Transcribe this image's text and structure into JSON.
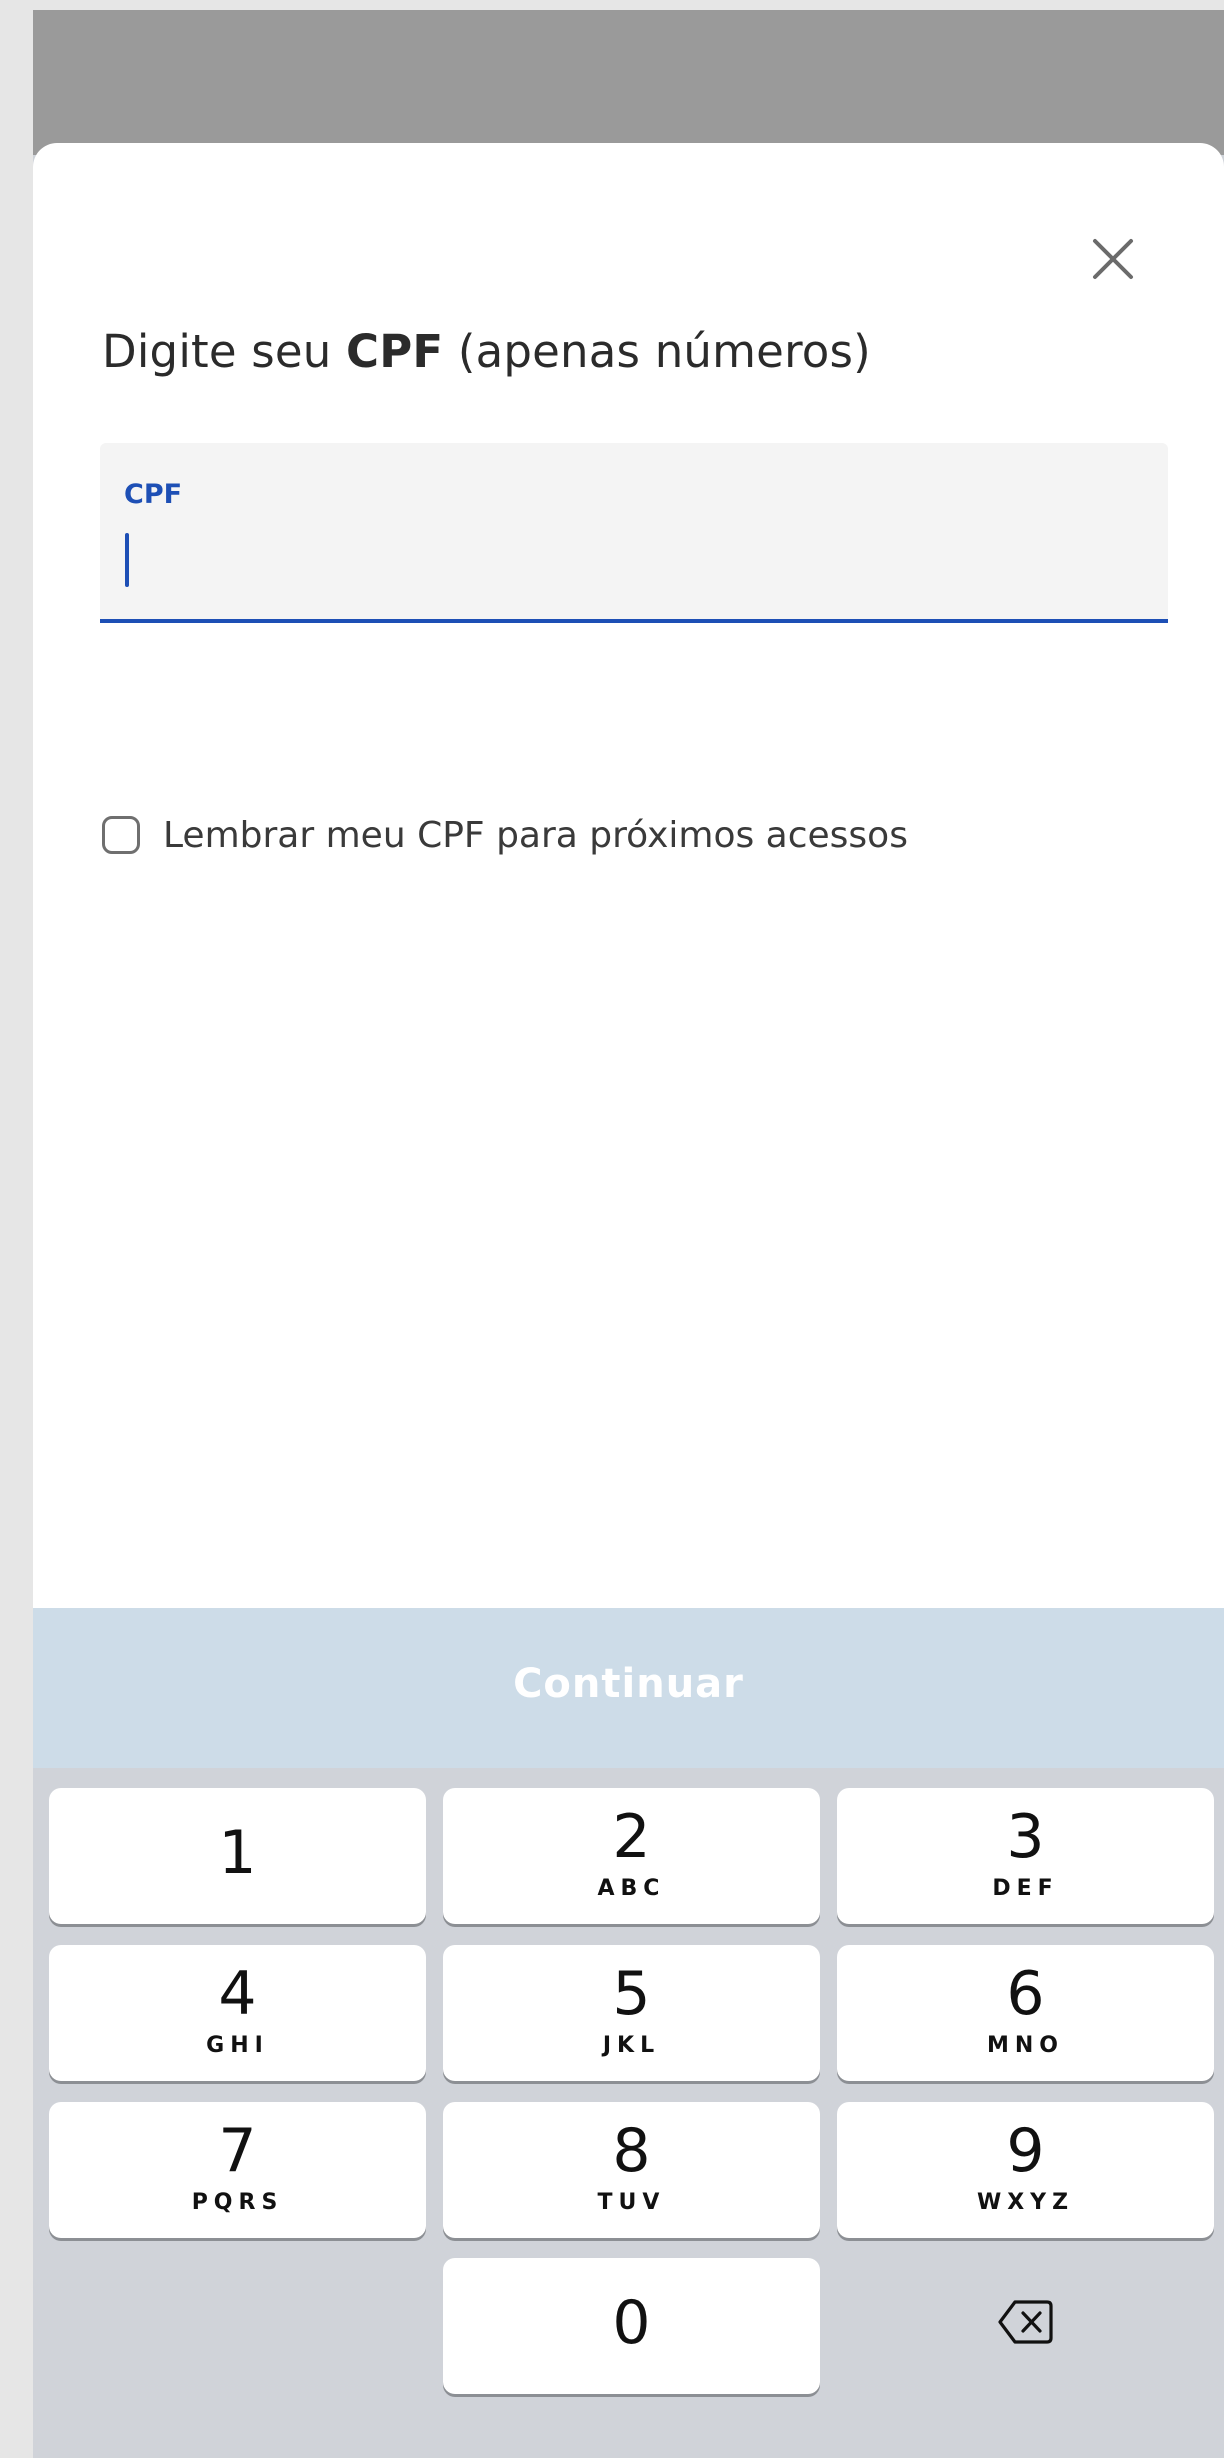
{
  "sheet": {
    "close_icon": "close-icon",
    "prompt_prefix": "Digite seu ",
    "prompt_bold": "CPF",
    "prompt_suffix": " (apenas números)"
  },
  "cpf_field": {
    "label": "CPF",
    "value": "",
    "accent_color": "#1d4fb5"
  },
  "remember": {
    "label": "Lembrar meu CPF para próximos acessos",
    "checked": false
  },
  "continue_button": {
    "label": "Continuar",
    "enabled": false,
    "background": "#cddce8"
  },
  "keypad": {
    "keys": [
      {
        "digit": "1",
        "letters": ""
      },
      {
        "digit": "2",
        "letters": "ABC"
      },
      {
        "digit": "3",
        "letters": "DEF"
      },
      {
        "digit": "4",
        "letters": "GHI"
      },
      {
        "digit": "5",
        "letters": "JKL"
      },
      {
        "digit": "6",
        "letters": "MNO"
      },
      {
        "digit": "7",
        "letters": "PQRS"
      },
      {
        "digit": "8",
        "letters": "TUV"
      },
      {
        "digit": "9",
        "letters": "WXYZ"
      },
      {
        "digit": "0",
        "letters": ""
      }
    ],
    "backspace_icon": "backspace-icon"
  }
}
